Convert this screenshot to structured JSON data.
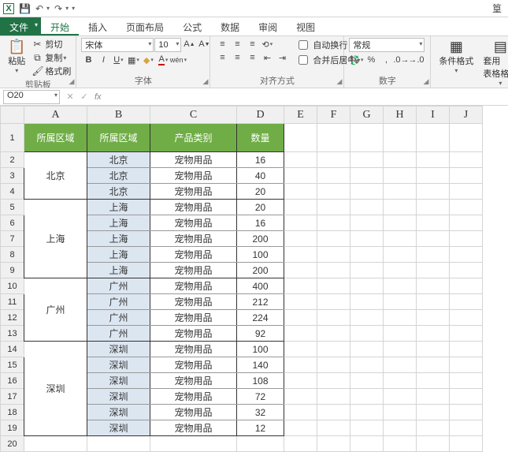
{
  "qat": {
    "save": "💾",
    "undo": "↶",
    "redo": "↷"
  },
  "title_right": "篁",
  "tabs": {
    "file": "文件",
    "home": "开始",
    "insert": "插入",
    "layout": "页面布局",
    "formulas": "公式",
    "data": "数据",
    "review": "审阅",
    "view": "视图"
  },
  "ribbon": {
    "clipboard": {
      "paste": "粘贴",
      "cut": "剪切",
      "copy": "复制",
      "painter": "格式刷",
      "label": "剪贴板"
    },
    "font": {
      "name": "宋体",
      "size": "10",
      "label": "字体"
    },
    "align": {
      "wrap": "自动换行",
      "merge": "合并后居中",
      "label": "对齐方式"
    },
    "number": {
      "format": "常规",
      "label": "数字"
    },
    "styles": {
      "cond": "条件格式",
      "table": "套用\n表格格式"
    }
  },
  "namebox": "O20",
  "columns": [
    "A",
    "B",
    "C",
    "D",
    "E",
    "F",
    "G",
    "H",
    "I",
    "J"
  ],
  "headers": {
    "region1": "所属区域",
    "region2": "所属区域",
    "category": "产品类别",
    "qty": "数量"
  },
  "blocks": [
    {
      "region": "北京",
      "rows": [
        {
          "city": "北京",
          "cat": "宠物用品",
          "qty": "16"
        },
        {
          "city": "北京",
          "cat": "宠物用品",
          "qty": "40"
        },
        {
          "city": "北京",
          "cat": "宠物用品",
          "qty": "20"
        }
      ]
    },
    {
      "region": "上海",
      "rows": [
        {
          "city": "上海",
          "cat": "宠物用品",
          "qty": "20"
        },
        {
          "city": "上海",
          "cat": "宠物用品",
          "qty": "16"
        },
        {
          "city": "上海",
          "cat": "宠物用品",
          "qty": "200"
        },
        {
          "city": "上海",
          "cat": "宠物用品",
          "qty": "100"
        },
        {
          "city": "上海",
          "cat": "宠物用品",
          "qty": "200"
        }
      ]
    },
    {
      "region": "广州",
      "rows": [
        {
          "city": "广州",
          "cat": "宠物用品",
          "qty": "400"
        },
        {
          "city": "广州",
          "cat": "宠物用品",
          "qty": "212"
        },
        {
          "city": "广州",
          "cat": "宠物用品",
          "qty": "224"
        },
        {
          "city": "广州",
          "cat": "宠物用品",
          "qty": "92"
        }
      ]
    },
    {
      "region": "深圳",
      "rows": [
        {
          "city": "深圳",
          "cat": "宠物用品",
          "qty": "100"
        },
        {
          "city": "深圳",
          "cat": "宠物用品",
          "qty": "140"
        },
        {
          "city": "深圳",
          "cat": "宠物用品",
          "qty": "108"
        },
        {
          "city": "深圳",
          "cat": "宠物用品",
          "qty": "72"
        },
        {
          "city": "深圳",
          "cat": "宠物用品",
          "qty": "32"
        },
        {
          "city": "深圳",
          "cat": "宠物用品",
          "qty": "12"
        }
      ]
    }
  ]
}
